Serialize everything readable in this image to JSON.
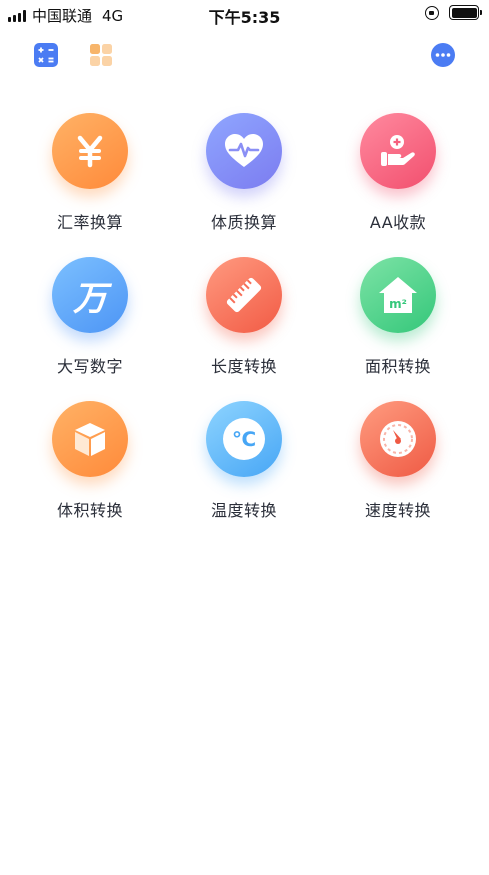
{
  "status_bar": {
    "carrier": "中国联通",
    "network": "4G",
    "time": "下午5:35"
  },
  "toolbar": {
    "left_icons": [
      "calculator-icon",
      "grid-icon"
    ],
    "right_icon": "more-icon",
    "accent_color": "#4b7cf3"
  },
  "tools": [
    {
      "label": "汇率换算",
      "icon": "yen-icon",
      "color": "#ff9a4d"
    },
    {
      "label": "体质换算",
      "icon": "heart-pulse-icon",
      "color": "#8a8ff5"
    },
    {
      "label": "AA收款",
      "icon": "hand-coin-icon",
      "color": "#f5607d"
    },
    {
      "label": "大写数字",
      "icon": "wan-character-icon",
      "color": "#5ea8f8"
    },
    {
      "label": "长度转换",
      "icon": "ruler-icon",
      "color": "#f76e58"
    },
    {
      "label": "面积转换",
      "icon": "house-area-icon",
      "color": "#4fd08c"
    },
    {
      "label": "体积转换",
      "icon": "cube-icon",
      "color": "#ff9d50"
    },
    {
      "label": "温度转换",
      "icon": "celsius-icon",
      "color": "#5cb5f8"
    },
    {
      "label": "速度转换",
      "icon": "speedometer-icon",
      "color": "#f46c55"
    }
  ],
  "glyphs": {
    "wan": "万",
    "celsius": "℃",
    "area_unit": "m²"
  }
}
